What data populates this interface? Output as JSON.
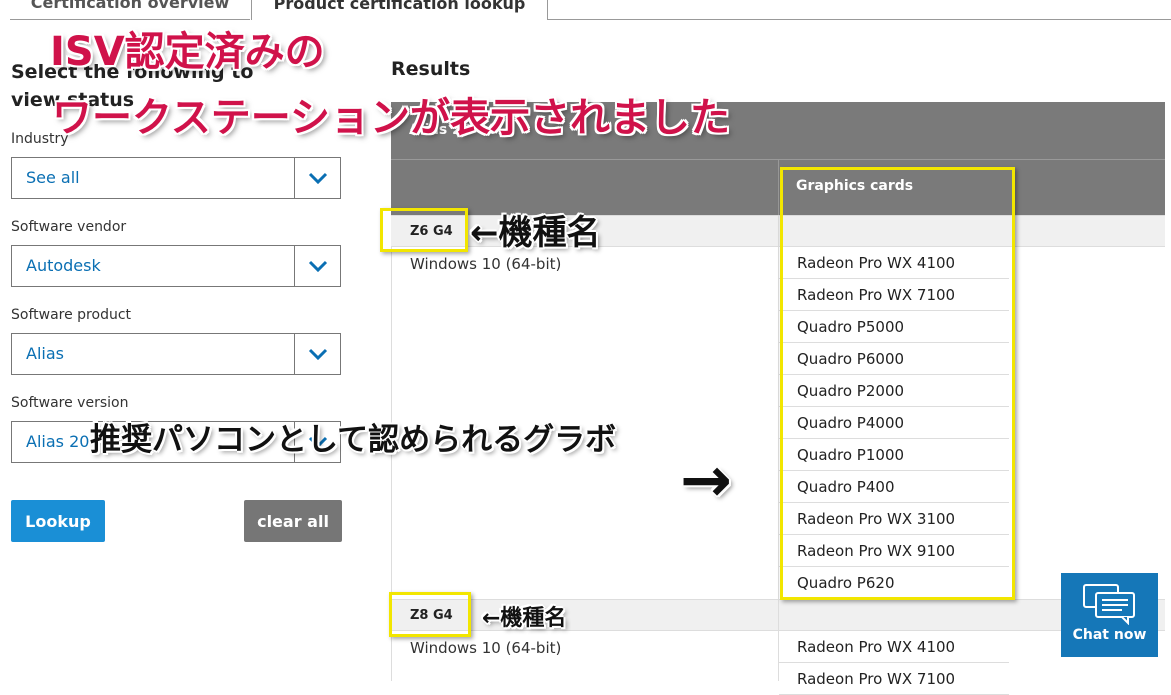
{
  "tabs": [
    {
      "label": "Certification overview"
    },
    {
      "label": "Product certification lookup"
    }
  ],
  "filters": {
    "heading": "Select the following to view status",
    "industry": {
      "label": "Industry",
      "value": "See all"
    },
    "vendor": {
      "label": "Software vendor",
      "value": "Autodesk"
    },
    "product": {
      "label": "Software product",
      "value": "Alias"
    },
    "version": {
      "label": "Software version",
      "value": "Alias 20"
    }
  },
  "buttons": {
    "lookup": "Lookup",
    "clear": "clear all"
  },
  "results": {
    "title": "Results",
    "header": "Alias 20   64",
    "graphics_cards_label": "Graphics cards",
    "models": [
      {
        "name": "Z6 G4",
        "os": "Windows 10 (64-bit)",
        "cards": [
          "Radeon Pro WX 4100",
          "Radeon Pro WX 7100",
          "Quadro P5000",
          "Quadro P6000",
          "Quadro P2000",
          "Quadro P4000",
          "Quadro P1000",
          "Quadro P400",
          "Radeon Pro WX 3100",
          "Radeon Pro WX 9100",
          "Quadro P620"
        ]
      },
      {
        "name": "Z8 G4",
        "os": "Windows 10 (64-bit)",
        "cards": [
          "Radeon Pro WX 4100",
          "Radeon Pro WX 7100"
        ]
      }
    ]
  },
  "annotations": {
    "title_line1": "ISV認定済みの",
    "title_line2": "ワークステーションが表示されました",
    "model_label_1": "←機種名",
    "model_label_2": "←機種名",
    "gpu_note": "推奨パソコンとして認められるグラボ",
    "arrow": "→"
  },
  "chat": {
    "label": "Chat now"
  },
  "colors": {
    "accent_blue": "#1a8fd6",
    "annotation_red": "#d0124a",
    "highlight_yellow": "#f2e600",
    "header_gray": "#7a7a7a"
  }
}
